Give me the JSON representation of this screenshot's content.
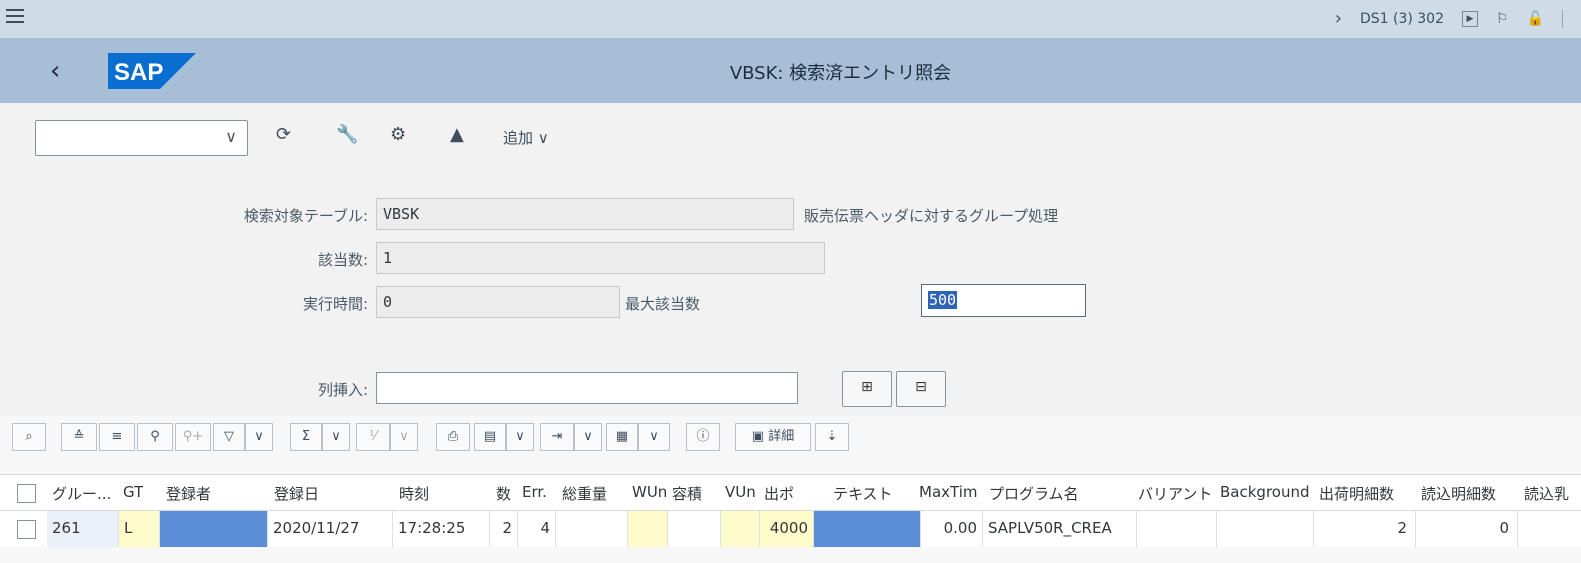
{
  "topbar": {
    "system": "DS1 (3) 302"
  },
  "shell": {
    "title": "VBSK: 検索済エントリ照会",
    "logo_text": "SAP"
  },
  "toolbar": {
    "add_label": "追加"
  },
  "form": {
    "table_label": "検索対象テーブル:",
    "table_value": "VBSK",
    "table_desc": "販売伝票ヘッダに対するグループ処理",
    "hits_label": "該当数:",
    "hits_value": "1",
    "runtime_label": "実行時間:",
    "runtime_value": "0",
    "maxhits_label": "最大該当数",
    "maxhits_value": "500",
    "insert_label": "列挿入:",
    "insert_value": ""
  },
  "alv": {
    "detail_label": "詳細"
  },
  "table": {
    "headers": [
      "グルー...",
      "GT",
      "登録者",
      "登録日",
      "時刻",
      "数",
      "Err.",
      "総重量",
      "WUn",
      "容積",
      "VUn",
      "出ポ",
      "テキスト",
      "MaxTim",
      "プログラム名",
      "バリアント",
      "Background",
      "出荷明細数",
      "読込明細数",
      "読込乳"
    ],
    "row": [
      "261",
      "L",
      "",
      "2020/11/27",
      "17:28:25",
      "2",
      "4",
      "",
      "",
      "",
      "",
      "4000",
      "",
      "0.00",
      "SAPLV50R_CREA",
      "",
      "",
      "2",
      "0",
      ""
    ]
  }
}
